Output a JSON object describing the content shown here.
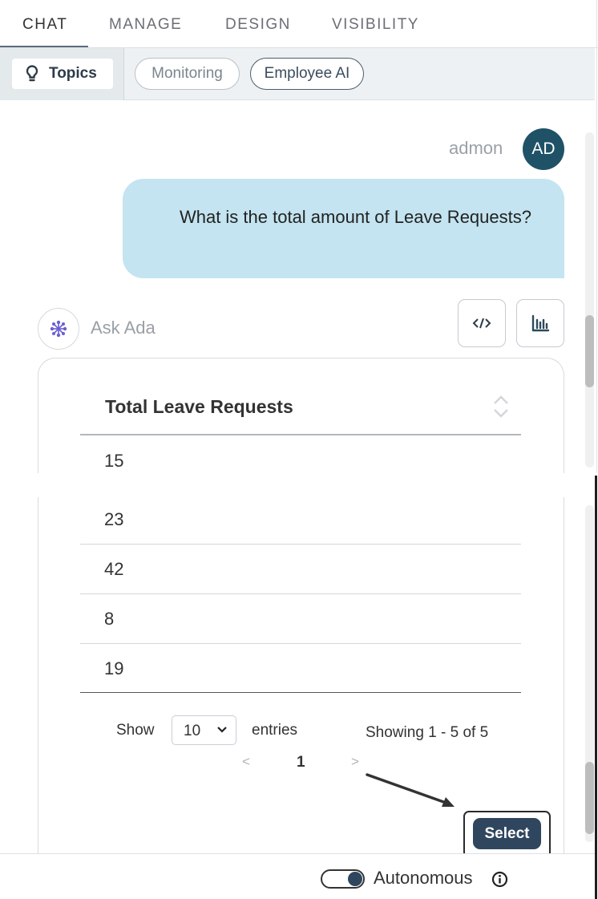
{
  "tabs": [
    {
      "label": "CHAT",
      "active": true
    },
    {
      "label": "MANAGE",
      "active": false
    },
    {
      "label": "DESIGN",
      "active": false
    },
    {
      "label": "VISIBILITY",
      "active": false
    }
  ],
  "subbar": {
    "topics_label": "Topics",
    "chips": [
      "Monitoring",
      "Employee AI"
    ]
  },
  "chat": {
    "user_name": "admon",
    "avatar_initials": "AD",
    "user_message": "What is the total amount of Leave Requests?",
    "assistant_label": "Ask Ada"
  },
  "table": {
    "header": "Total Leave Requests",
    "rows": [
      "15",
      "23",
      "42",
      "8",
      "19"
    ],
    "show_label": "Show",
    "page_size": "10",
    "entries_label": "entries",
    "showing_text": "Showing 1 - 5 of 5",
    "prev": "<",
    "current_page": "1",
    "next": ">"
  },
  "select_label": "Select",
  "footer": {
    "autonomous_label": "Autonomous",
    "autonomous_on": true
  },
  "colors": {
    "accent": "#2f465e",
    "bubble": "#c3e4f0",
    "avatar": "#1f5267"
  },
  "icons": {
    "topics": "lightbulb-icon",
    "assistant": "network-nodes-icon",
    "code": "code-icon",
    "chart": "bar-chart-icon",
    "sort": "sort-icon",
    "info": "info-icon"
  }
}
